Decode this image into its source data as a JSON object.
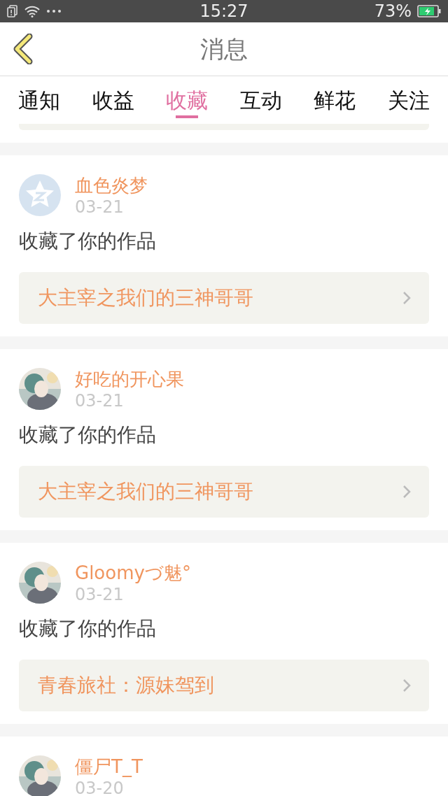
{
  "status_bar": {
    "time": "15:27",
    "battery": "73%"
  },
  "header": {
    "title": "消息"
  },
  "tabs": [
    {
      "label": "通知",
      "selected": false
    },
    {
      "label": "收益",
      "selected": false
    },
    {
      "label": "收藏",
      "selected": true
    },
    {
      "label": "互动",
      "selected": false
    },
    {
      "label": "鲜花",
      "selected": false
    },
    {
      "label": "关注",
      "selected": false
    }
  ],
  "messages": [
    {
      "avatar": {
        "kind": "default"
      },
      "user": "血色炎梦",
      "date": "03-21",
      "action": "收藏了你的作品",
      "work": "大主宰之我们的三神哥哥"
    },
    {
      "user": "好吃的开心果",
      "date": "03-21",
      "action": "收藏了你的作品",
      "work": "大主宰之我们的三神哥哥"
    },
    {
      "user": "Gloomyづ魅°",
      "date": "03-21",
      "action": "收藏了你的作品",
      "work": "青春旅社：源妹驾到"
    },
    {
      "user": "僵尸T_T",
      "date": "03-20"
    }
  ]
}
